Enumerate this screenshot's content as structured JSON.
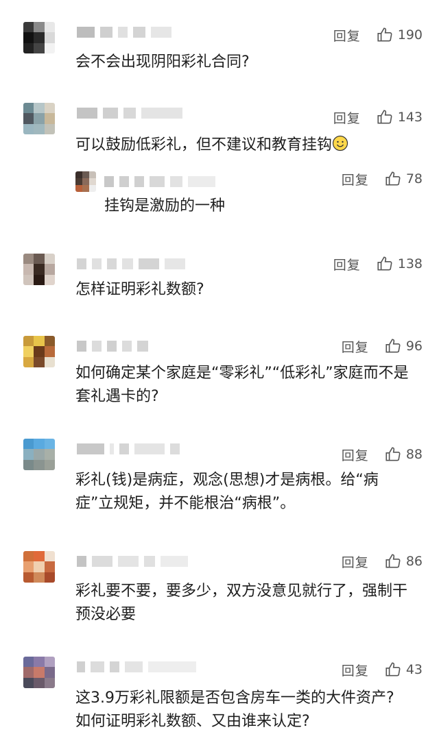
{
  "reply_label": "回复",
  "comments": [
    {
      "likes": "190",
      "text": "会不会出现阴阳彩礼合同?"
    },
    {
      "likes": "143",
      "text": "可以鼓励低彩礼，但不建议和教育挂钩"
    },
    {
      "likes": "78",
      "text": "挂钩是激励的一种"
    },
    {
      "likes": "138",
      "text": "怎样证明彩礼数额?"
    },
    {
      "likes": "96",
      "text": "如何确定某个家庭是“零彩礼”“低彩礼”家庭而不是套礼遇卡的?"
    },
    {
      "likes": "88",
      "text": "彩礼(钱)是病症，观念(思想)才是病根。给“病症”立规矩，并不能根治“病根”。"
    },
    {
      "likes": "86",
      "text": "彩礼要不要，要多少，双方没意见就行了，强制干预没必要"
    },
    {
      "likes": "43",
      "text": "这3.9万彩礼限额是否包含房车一类的大件资产? 如何证明彩礼数额、又由谁来认定?"
    }
  ]
}
